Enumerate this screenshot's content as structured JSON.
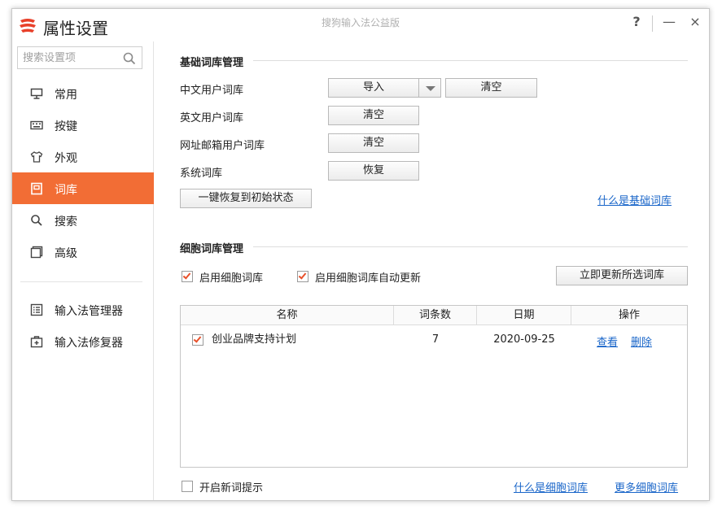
{
  "window": {
    "app_title": "属性设置",
    "caption": "搜狗输入法公益版",
    "help": "?",
    "minimize": "—",
    "close": "×"
  },
  "sidebar": {
    "search_placeholder": "搜索设置项",
    "items": [
      {
        "label": "常用",
        "icon": "monitor-icon",
        "active": false
      },
      {
        "label": "按键",
        "icon": "keyboard-icon",
        "active": false
      },
      {
        "label": "外观",
        "icon": "shirt-icon",
        "active": false
      },
      {
        "label": "词库",
        "icon": "dictionary-icon",
        "active": true
      },
      {
        "label": "搜索",
        "icon": "search-icon",
        "active": false
      },
      {
        "label": "高级",
        "icon": "advanced-icon",
        "active": false
      }
    ],
    "tools": [
      {
        "label": "输入法管理器",
        "icon": "manager-icon"
      },
      {
        "label": "输入法修复器",
        "icon": "repair-icon"
      }
    ]
  },
  "basic": {
    "title": "基础词库管理",
    "chinese_user_label": "中文用户词库",
    "import_label": "导入",
    "clear_label": "清空",
    "english_user_label": "英文用户词库",
    "english_clear_label": "清空",
    "web_email_label": "网址邮箱用户词库",
    "web_clear_label": "清空",
    "system_label": "系统词库",
    "restore_label": "恢复",
    "reset_all_label": "一键恢复到初始状态",
    "what_is_link": "什么是基础词库"
  },
  "cell": {
    "title": "细胞词库管理",
    "enable_label": "启用细胞词库",
    "enable_checked": true,
    "auto_update_label": "启用细胞词库自动更新",
    "auto_update_checked": true,
    "update_now_label": "立即更新所选词库",
    "columns": [
      "名称",
      "词条数",
      "日期",
      "操作"
    ],
    "rows": [
      {
        "checked": true,
        "name": "创业品牌支持计划",
        "count": "7",
        "date": "2020-09-25",
        "view": "查看",
        "delete": "删除"
      }
    ],
    "new_word_tip_label": "开启新词提示",
    "new_word_tip_checked": false,
    "what_is_link": "什么是细胞词库",
    "more_link": "更多细胞词库"
  },
  "colors": {
    "accent": "#f26d35",
    "link": "#1a66c9",
    "check": "#e8502a"
  }
}
